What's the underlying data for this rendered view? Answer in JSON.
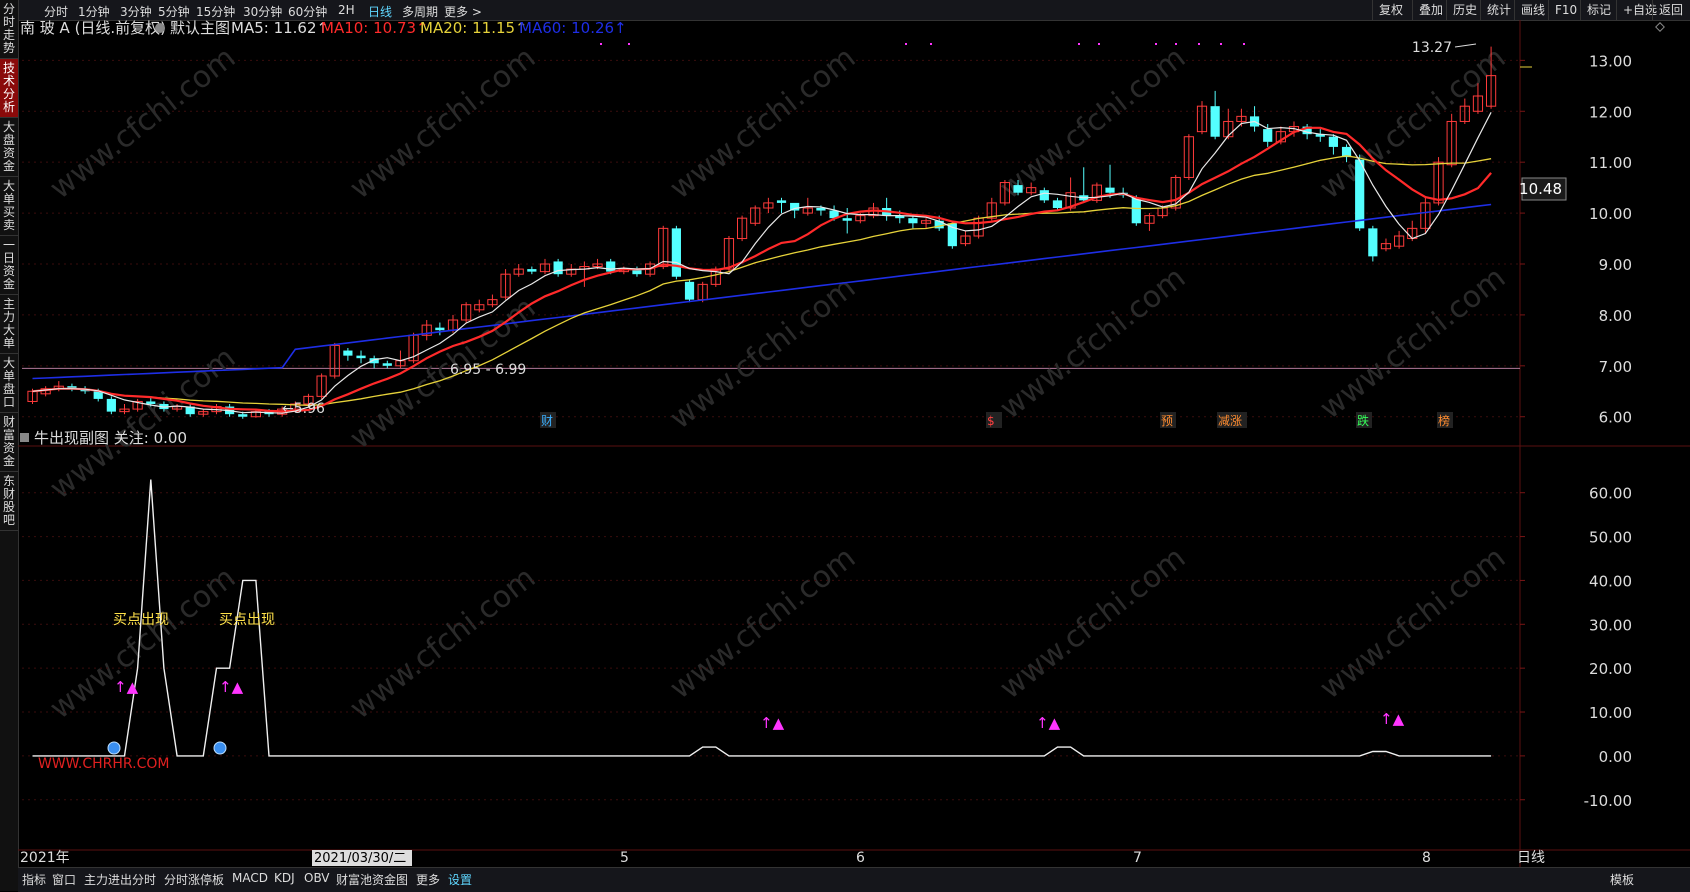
{
  "timeframes": [
    "分时",
    "1分钟",
    "3分钟",
    "5分钟",
    "15分钟",
    "30分钟",
    "60分钟",
    "2H",
    "日线",
    "多周期",
    "更多 >"
  ],
  "active_timeframe": "日线",
  "right_tools": [
    "复权",
    "叠加",
    "历史",
    "统计",
    "画线",
    "F10",
    "标记",
    "+自选",
    "返回"
  ],
  "side_tabs": [
    "分时走势",
    "技术分析",
    "大盘资金",
    "大单买卖",
    "一日资金",
    "主力大单",
    "大单盘口",
    "财富资金",
    "东财股吧"
  ],
  "main_title": {
    "stock": "南 玻 A",
    "mode": "(日线.前复权)",
    "template": "默认主图",
    "ma5": "MA5: 11.62↑",
    "ma10": "MA10: 10.73↑",
    "ma20": "MA20: 11.15↑",
    "ma60": "MA60: 10.26↑"
  },
  "sub_title": "牛出现副图 关注: 0.00",
  "annotations": {
    "high": "13.27",
    "low": "5.96",
    "range": "6.95 - 6.99",
    "price_tag": "10.48",
    "buy_signal": "买点出现",
    "watermark": "www.cfchi.com",
    "logo": "WWW.CHRHR.COM"
  },
  "event_markers": [
    "财",
    "$",
    "预",
    "减涨",
    "跌",
    "榜"
  ],
  "bottom_axis": {
    "start": "2021年",
    "cursor": "2021/03/30/二",
    "months": [
      "5",
      "6",
      "7",
      "8"
    ],
    "right": "日线"
  },
  "bottom_tabs": [
    "指标",
    "窗口",
    "主力进出分时",
    "分时涨停板",
    "MACD",
    "KDJ",
    "OBV",
    "财富池资金图",
    "更多",
    "设置"
  ],
  "bottom_right": "模板",
  "colors": {
    "up": "#ff3b3b",
    "down": "#54ffff",
    "ma5": "#e8e8e8",
    "ma10": "#ff2a2a",
    "ma20": "#e6d23a",
    "ma60": "#1e2ee6",
    "magenta": "#ff35ff",
    "yellow": "#ffe14a"
  },
  "chart_data": [
    {
      "type": "candlestick",
      "title": "默认主图",
      "yticks": [
        6,
        7,
        8,
        9,
        10,
        11,
        12,
        13
      ],
      "ylim": [
        5.7,
        13.4
      ],
      "reference_line": 6.95,
      "x_labels": [
        "2021年",
        "5",
        "6",
        "7",
        "8"
      ],
      "series": [
        {
          "name": "MA5",
          "value": 11.62
        },
        {
          "name": "MA10",
          "value": 10.73
        },
        {
          "name": "MA20",
          "value": 11.15
        },
        {
          "name": "MA60",
          "value": 10.26
        }
      ],
      "candles": [
        [
          6.3,
          6.5,
          6.25,
          6.55
        ],
        [
          6.45,
          6.55,
          6.4,
          6.6
        ],
        [
          6.55,
          6.6,
          6.5,
          6.7
        ],
        [
          6.6,
          6.55,
          6.5,
          6.65
        ],
        [
          6.55,
          6.5,
          6.45,
          6.6
        ],
        [
          6.5,
          6.35,
          6.3,
          6.55
        ],
        [
          6.35,
          6.1,
          6.05,
          6.4
        ],
        [
          6.1,
          6.15,
          6.05,
          6.25
        ],
        [
          6.15,
          6.3,
          6.1,
          6.35
        ],
        [
          6.3,
          6.25,
          6.2,
          6.4
        ],
        [
          6.25,
          6.15,
          6.1,
          6.3
        ],
        [
          6.15,
          6.2,
          6.1,
          6.25
        ],
        [
          6.2,
          6.05,
          6.0,
          6.25
        ],
        [
          6.05,
          6.1,
          6.0,
          6.15
        ],
        [
          6.1,
          6.2,
          6.05,
          6.25
        ],
        [
          6.2,
          6.05,
          6.0,
          6.25
        ],
        [
          6.05,
          6.0,
          5.96,
          6.1
        ],
        [
          6.0,
          6.1,
          5.98,
          6.15
        ],
        [
          6.1,
          6.05,
          6.0,
          6.15
        ],
        [
          6.05,
          6.15,
          6.0,
          6.2
        ],
        [
          6.15,
          6.25,
          6.1,
          6.3
        ],
        [
          6.25,
          6.4,
          6.2,
          6.45
        ],
        [
          6.4,
          6.8,
          6.35,
          6.85
        ],
        [
          6.8,
          7.4,
          6.75,
          7.45
        ],
        [
          7.3,
          7.2,
          7.1,
          7.35
        ],
        [
          7.2,
          7.15,
          7.05,
          7.3
        ],
        [
          7.15,
          7.05,
          6.95,
          7.2
        ],
        [
          7.05,
          7.0,
          6.95,
          7.1
        ],
        [
          7.0,
          7.1,
          6.95,
          7.3
        ],
        [
          7.1,
          7.6,
          7.05,
          7.65
        ],
        [
          7.6,
          7.8,
          7.5,
          7.9
        ],
        [
          7.75,
          7.7,
          7.6,
          7.85
        ],
        [
          7.7,
          7.9,
          7.65,
          8.0
        ],
        [
          7.9,
          8.2,
          7.85,
          8.25
        ],
        [
          8.1,
          8.2,
          8.05,
          8.3
        ],
        [
          8.2,
          8.3,
          8.15,
          8.4
        ],
        [
          8.35,
          8.8,
          8.3,
          8.9
        ],
        [
          8.8,
          8.9,
          8.75,
          9.0
        ],
        [
          8.9,
          8.85,
          8.8,
          8.95
        ],
        [
          8.85,
          9.0,
          8.8,
          9.1
        ],
        [
          9.05,
          8.8,
          8.75,
          9.1
        ],
        [
          8.8,
          8.9,
          8.75,
          9.0
        ],
        [
          8.9,
          8.95,
          8.55,
          9.05
        ],
        [
          8.95,
          9.0,
          8.9,
          9.1
        ],
        [
          9.05,
          8.85,
          8.8,
          9.1
        ],
        [
          8.85,
          8.9,
          8.8,
          8.95
        ],
        [
          8.9,
          8.8,
          8.75,
          8.95
        ],
        [
          8.8,
          9.0,
          8.75,
          9.05
        ],
        [
          8.95,
          9.7,
          8.9,
          9.75
        ],
        [
          9.7,
          8.75,
          8.7,
          9.75
        ],
        [
          8.65,
          8.3,
          8.25,
          8.7
        ],
        [
          8.3,
          8.6,
          8.25,
          8.65
        ],
        [
          8.6,
          8.9,
          8.55,
          8.95
        ],
        [
          8.9,
          9.5,
          8.85,
          9.55
        ],
        [
          9.5,
          9.9,
          9.45,
          9.95
        ],
        [
          9.8,
          10.1,
          9.75,
          10.15
        ],
        [
          10.1,
          10.2,
          10.0,
          10.3
        ],
        [
          10.25,
          10.2,
          10.0,
          10.3
        ],
        [
          10.2,
          10.05,
          9.9,
          10.1
        ],
        [
          10.0,
          10.1,
          9.95,
          10.3
        ],
        [
          10.1,
          10.05,
          9.95,
          10.15
        ],
        [
          10.05,
          9.9,
          9.85,
          10.15
        ],
        [
          9.9,
          9.85,
          9.6,
          10.1
        ],
        [
          9.85,
          9.95,
          9.8,
          10.0
        ],
        [
          9.95,
          10.1,
          9.9,
          10.2
        ],
        [
          10.1,
          9.95,
          9.85,
          10.3
        ],
        [
          9.95,
          9.9,
          9.8,
          10.05
        ],
        [
          9.9,
          9.8,
          9.7,
          9.95
        ],
        [
          9.8,
          9.85,
          9.7,
          9.9
        ],
        [
          9.85,
          9.7,
          9.65,
          9.95
        ],
        [
          9.8,
          9.35,
          9.3,
          9.85
        ],
        [
          9.4,
          9.55,
          9.35,
          9.65
        ],
        [
          9.55,
          9.9,
          9.5,
          9.95
        ],
        [
          9.9,
          10.2,
          9.85,
          10.3
        ],
        [
          10.2,
          10.6,
          10.15,
          10.65
        ],
        [
          10.55,
          10.4,
          10.35,
          10.65
        ],
        [
          10.4,
          10.5,
          10.35,
          10.6
        ],
        [
          10.45,
          10.25,
          10.2,
          10.5
        ],
        [
          10.25,
          10.1,
          10.05,
          10.3
        ],
        [
          10.1,
          10.4,
          10.05,
          10.7
        ],
        [
          10.35,
          10.25,
          10.2,
          10.9
        ],
        [
          10.25,
          10.55,
          10.2,
          10.6
        ],
        [
          10.5,
          10.4,
          10.3,
          10.95
        ],
        [
          10.4,
          10.35,
          10.3,
          10.5
        ],
        [
          10.3,
          9.8,
          9.75,
          10.35
        ],
        [
          9.8,
          9.95,
          9.65,
          10.0
        ],
        [
          9.95,
          10.1,
          9.9,
          10.15
        ],
        [
          10.1,
          10.7,
          10.05,
          10.75
        ],
        [
          10.7,
          11.5,
          10.65,
          11.55
        ],
        [
          11.6,
          12.1,
          11.55,
          12.2
        ],
        [
          12.1,
          11.5,
          11.45,
          12.4
        ],
        [
          11.5,
          11.8,
          11.45,
          12.05
        ],
        [
          11.8,
          11.9,
          11.7,
          12.05
        ],
        [
          11.9,
          11.7,
          11.6,
          12.1
        ],
        [
          11.65,
          11.4,
          11.3,
          11.75
        ],
        [
          11.4,
          11.6,
          11.35,
          11.7
        ],
        [
          11.6,
          11.7,
          11.5,
          11.8
        ],
        [
          11.7,
          11.55,
          11.45,
          11.75
        ],
        [
          11.55,
          11.5,
          11.4,
          11.65
        ],
        [
          11.5,
          11.3,
          11.15,
          11.55
        ],
        [
          11.3,
          11.1,
          11.0,
          11.35
        ],
        [
          11.05,
          9.7,
          9.65,
          11.15
        ],
        [
          9.7,
          9.15,
          9.05,
          9.75
        ],
        [
          9.3,
          9.4,
          9.25,
          9.5
        ],
        [
          9.35,
          9.55,
          9.3,
          9.65
        ],
        [
          9.5,
          9.7,
          9.45,
          9.85
        ],
        [
          9.7,
          10.2,
          9.6,
          10.3
        ],
        [
          10.2,
          11.0,
          10.15,
          11.1
        ],
        [
          10.95,
          11.8,
          10.9,
          11.95
        ],
        [
          11.8,
          12.1,
          11.75,
          12.25
        ],
        [
          12.0,
          12.3,
          11.95,
          12.55
        ],
        [
          12.1,
          12.7,
          12.05,
          13.27
        ]
      ]
    },
    {
      "type": "line",
      "title": "牛出现副图 关注: 0.00",
      "yticks": [
        -10,
        0,
        10,
        20,
        30,
        40,
        50,
        60
      ],
      "ylim": [
        -21,
        67
      ],
      "signal_labels": [
        "买点出现",
        "买点出现"
      ],
      "values": [
        0,
        0,
        0,
        0,
        0,
        0,
        0,
        0,
        20,
        63,
        20,
        0,
        0,
        0,
        20,
        20,
        40,
        40,
        0,
        0,
        0,
        0,
        0,
        0,
        0,
        0,
        0,
        0,
        0,
        0,
        0,
        0,
        0,
        0,
        0,
        0,
        0,
        0,
        0,
        0,
        0,
        0,
        0,
        0,
        0,
        0,
        0,
        0,
        0,
        0,
        0,
        2,
        2,
        0,
        0,
        0,
        0,
        0,
        0,
        0,
        0,
        0,
        0,
        0,
        0,
        0,
        0,
        0,
        0,
        0,
        0,
        0,
        0,
        0,
        0,
        0,
        0,
        0,
        2,
        2,
        0,
        0,
        0,
        0,
        0,
        0,
        0,
        0,
        0,
        0,
        0,
        0,
        0,
        0,
        0,
        0,
        0,
        0,
        0,
        0,
        0,
        0,
        1,
        1,
        0,
        0,
        0,
        0,
        0,
        0,
        0,
        0,
        0,
        0,
        0,
        0,
        3,
        3,
        0,
        0,
        0,
        0,
        0,
        0
      ]
    }
  ]
}
